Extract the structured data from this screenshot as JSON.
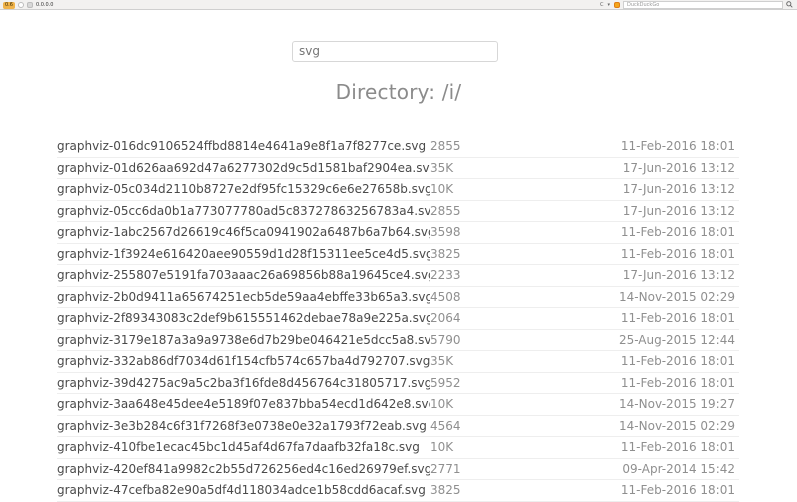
{
  "browser": {
    "badge": "0.6",
    "url": "0.0.0.0",
    "search_engine": "DuckDuckGo",
    "nav_glyphs": {
      "reload": "C",
      "menu": "▾"
    }
  },
  "search": {
    "value": "",
    "placeholder": "svg"
  },
  "page": {
    "title": "Directory: /i/"
  },
  "files": [
    {
      "name": "graphviz-016dc9106524ffbd8814e4641a9e8f1a7f8277ce.svg",
      "size": "2855",
      "date": "11-Feb-2016 18:01"
    },
    {
      "name": "graphviz-01d626aa692d47a6277302d9c5d1581baf2904ea.svg",
      "size": "35K",
      "date": "17-Jun-2016 13:12"
    },
    {
      "name": "graphviz-05c034d2110b8727e2df95fc15329c6e6e27658b.svg",
      "size": "10K",
      "date": "17-Jun-2016 13:12"
    },
    {
      "name": "graphviz-05cc6da0b1a773077780ad5c83727863256783a4.svg",
      "size": "2855",
      "date": "17-Jun-2016 13:12"
    },
    {
      "name": "graphviz-1abc2567d26619c46f5ca0941902a6487b6a7b64.svg",
      "size": "3598",
      "date": "11-Feb-2016 18:01"
    },
    {
      "name": "graphviz-1f3924e616420aee90559d1d28f15311ee5ce4d5.svg",
      "size": "3825",
      "date": "11-Feb-2016 18:01"
    },
    {
      "name": "graphviz-255807e5191fa703aaac26a69856b88a19645ce4.svg",
      "size": "2233",
      "date": "17-Jun-2016 13:12"
    },
    {
      "name": "graphviz-2b0d9411a65674251ecb5de59aa4ebffe33b65a3.svg",
      "size": "4508",
      "date": "14-Nov-2015 02:29"
    },
    {
      "name": "graphviz-2f89343083c2def9b615551462debae78a9e225a.svg",
      "size": "2064",
      "date": "11-Feb-2016 18:01"
    },
    {
      "name": "graphviz-3179e187a3a9a9738e6d7b29be046421e5dcc5a8.svg",
      "size": "5790",
      "date": "25-Aug-2015 12:44"
    },
    {
      "name": "graphviz-332ab86df7034d61f154cfb574c657ba4d792707.svg",
      "size": "35K",
      "date": "11-Feb-2016 18:01"
    },
    {
      "name": "graphviz-39d4275ac9a5c2ba3f16fde8d456764c31805717.svg",
      "size": "5952",
      "date": "11-Feb-2016 18:01"
    },
    {
      "name": "graphviz-3aa648e45dee4e5189f07e837bba54ecd1d642e8.svg",
      "size": "10K",
      "date": "14-Nov-2015 19:27"
    },
    {
      "name": "graphviz-3e3b284c6f31f7268f3e0738e0e32a1793f72eab.svg",
      "size": "4564",
      "date": "14-Nov-2015 02:29"
    },
    {
      "name": "graphviz-410fbe1ecac45bc1d45af4d67fa7daafb32fa18c.svg",
      "size": "10K",
      "date": "11-Feb-2016 18:01"
    },
    {
      "name": "graphviz-420ef841a9982c2b55d726256ed4c16ed26979ef.svg",
      "size": "2771",
      "date": "09-Apr-2014 15:42"
    },
    {
      "name": "graphviz-47cefba82e90a5df4d118034adce1b58cdd6acaf.svg",
      "size": "3825",
      "date": "11-Feb-2016 18:01"
    }
  ]
}
